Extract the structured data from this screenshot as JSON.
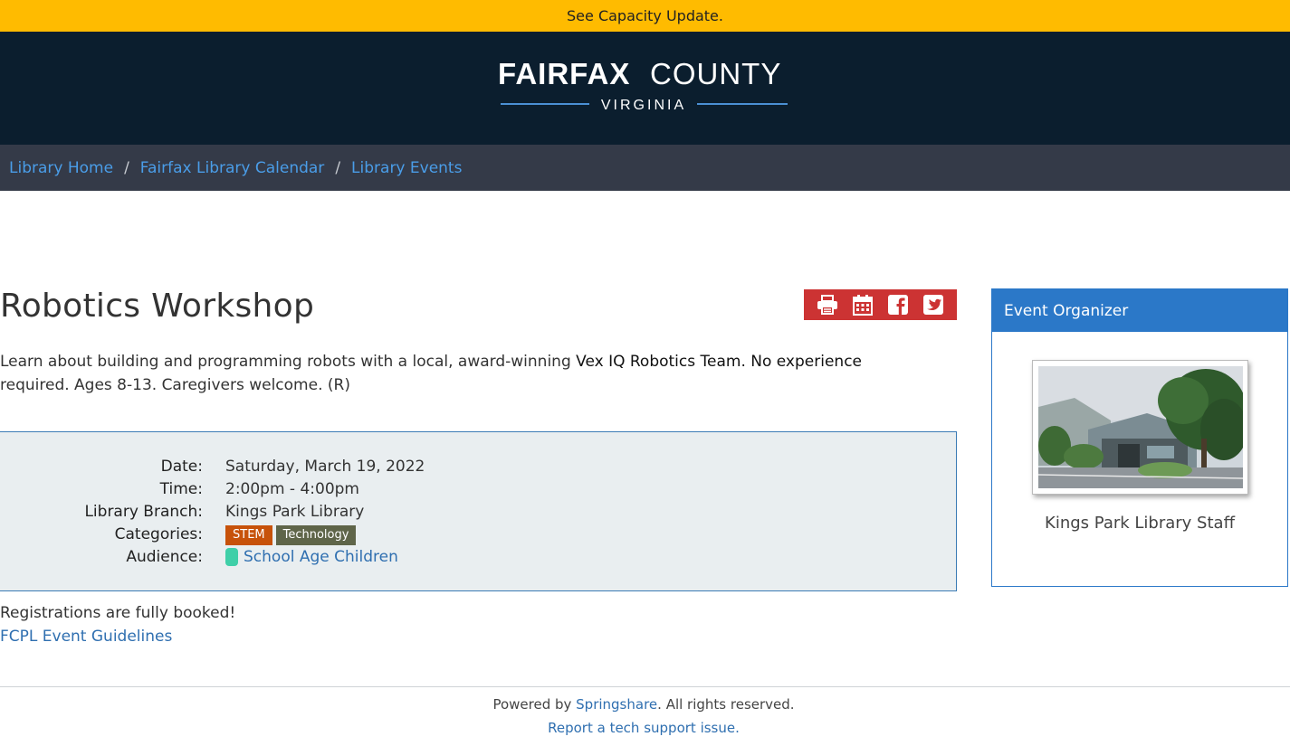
{
  "alert": {
    "text": "See Capacity Update."
  },
  "logo": {
    "word_bold": "FAIRFAX",
    "word_light": "COUNTY",
    "state": "VIRGINIA"
  },
  "breadcrumb": {
    "items": [
      "Library Home",
      "Fairfax Library Calendar",
      "Library Events"
    ],
    "separator": "/"
  },
  "event": {
    "title": "Robotics Workshop",
    "description_before": "Learn about building and programming robots with a local, award-winning ",
    "description_dark": "Vex IQ Robotics Team. No experience",
    "description_after": "required. Ages 8-13. Caregivers welcome. (R)"
  },
  "toolbar": {
    "icons": [
      "print-icon",
      "calendar-icon",
      "facebook-icon",
      "twitter-icon"
    ],
    "color": "#cc3333"
  },
  "details": {
    "date_label": "Date:",
    "date": "Saturday, March 19, 2022",
    "time_label": "Time:",
    "time": "2:00pm - 4:00pm",
    "branch_label": "Library Branch:",
    "branch": "Kings Park Library",
    "categories_label": "Categories:",
    "categories": [
      "STEM",
      "Technology"
    ],
    "audience_label": "Audience:",
    "audience": "School Age Children"
  },
  "registration": {
    "status": "Registrations are fully booked!",
    "guidelines_link": "FCPL Event Guidelines"
  },
  "organizer": {
    "header": "Event Organizer",
    "name": "Kings Park Library Staff"
  },
  "footer": {
    "powered_prefix": "Powered by ",
    "powered_link": "Springshare",
    "powered_suffix": ". All rights reserved.",
    "report": "Report a tech support issue."
  },
  "colors": {
    "alert": "#ffbb00",
    "masthead": "#0b1e2e",
    "breadcrumb_bg": "#343a48",
    "link": "#2f6fb0",
    "organizer": "#2b78c8",
    "stem": "#c7520a",
    "technology": "#5f6549",
    "audience": "#3fcfa8"
  }
}
